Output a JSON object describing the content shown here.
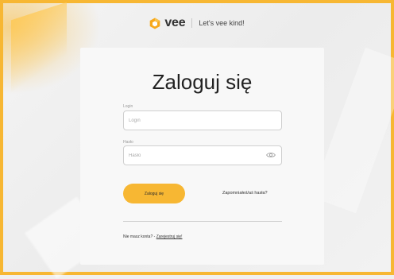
{
  "header": {
    "logo_text": "vee",
    "tagline": "Let's vee kind!"
  },
  "login": {
    "title": "Zaloguj się",
    "login_label": "Login",
    "login_placeholder": "Login",
    "login_value": "",
    "password_label": "Hasło",
    "password_placeholder": "Hasło",
    "password_value": "",
    "submit_label": "Zaloguj się",
    "forgot_link": "Zapomniałeś/aś hasła?",
    "register_prompt": "Nie masz konta? -",
    "register_link": "Zarejestruj się!"
  },
  "colors": {
    "accent": "#f7b733",
    "border": "#f7b733"
  },
  "icons": {
    "logo": "hexagon-logo-icon",
    "password_toggle": "eye-icon"
  }
}
